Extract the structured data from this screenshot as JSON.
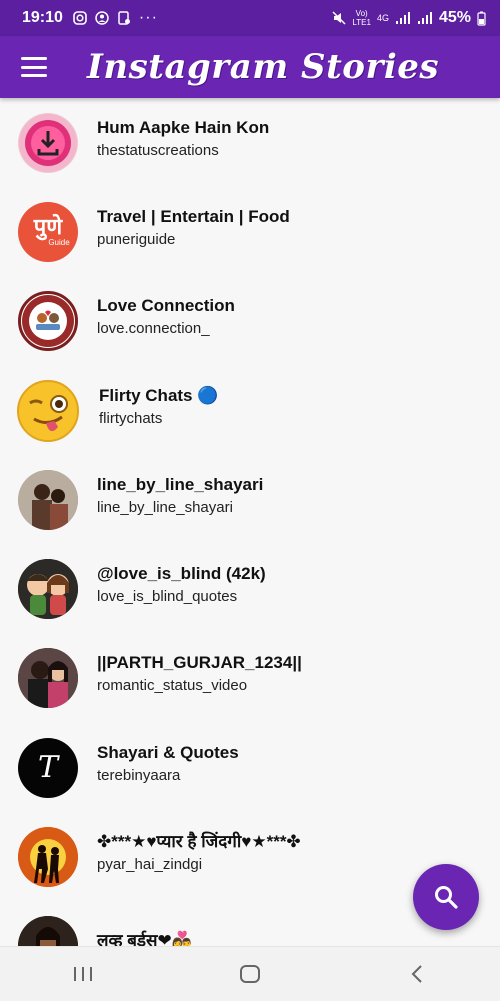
{
  "status_bar": {
    "time": "19:10",
    "network_top": "Vo)",
    "network_bottom": "LTE1",
    "network_type": "4G",
    "battery": "45%"
  },
  "app_bar": {
    "title": "Instagram Stories"
  },
  "items": [
    {
      "title": "Hum Aapke Hain Kon",
      "subtitle": "thestatuscreations"
    },
    {
      "title": "Travel | Entertain | Food",
      "subtitle": "puneriguide",
      "avatar_text": "पुणे",
      "avatar_subtext": "Guide"
    },
    {
      "title": "Love Connection",
      "subtitle": "love.connection_"
    },
    {
      "title": "Flirty Chats 🔵",
      "subtitle": "flirtychats"
    },
    {
      "title": "line_by_line_shayari",
      "subtitle": "line_by_line_shayari"
    },
    {
      "title": "@love_is_blind (42k)",
      "subtitle": "love_is_blind_quotes"
    },
    {
      "title": "||PARTH_GURJAR_1234||",
      "subtitle": "romantic_status_video"
    },
    {
      "title": "Shayari & Quotes",
      "subtitle": "terebinyaara",
      "avatar_text": "T"
    },
    {
      "title": "✤***★♥प्यार है जिंदगी♥★***✤",
      "subtitle": "pyar_hai_zindgi"
    },
    {
      "title": "लव्ह बर्डस❤👩‍❤️‍👨",
      "subtitle": ""
    }
  ],
  "fab": {
    "icon": "search-icon"
  },
  "nav": {
    "recent": "recent-apps-icon",
    "home": "home-icon",
    "back": "back-icon"
  },
  "colors": {
    "primary": "#6a25b3",
    "status_bar": "#5b1fa0"
  }
}
